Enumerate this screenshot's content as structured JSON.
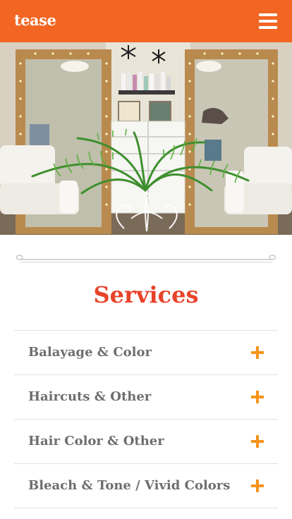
{
  "header": {
    "logo_text": "tease",
    "menu_icon": "hamburger-icon",
    "bar_color": "#f26522"
  },
  "hero": {
    "image_subject": "salon-interior-photo"
  },
  "services": {
    "title": "Services",
    "title_color": "#e8432a",
    "expand_icon": "plus-icon",
    "accent_color": "#f7941d",
    "items": [
      {
        "label": "Balayage & Color"
      },
      {
        "label": "Haircuts & Other"
      },
      {
        "label": "Hair Color & Other"
      },
      {
        "label": "Bleach & Tone / Vivid Colors"
      }
    ]
  }
}
